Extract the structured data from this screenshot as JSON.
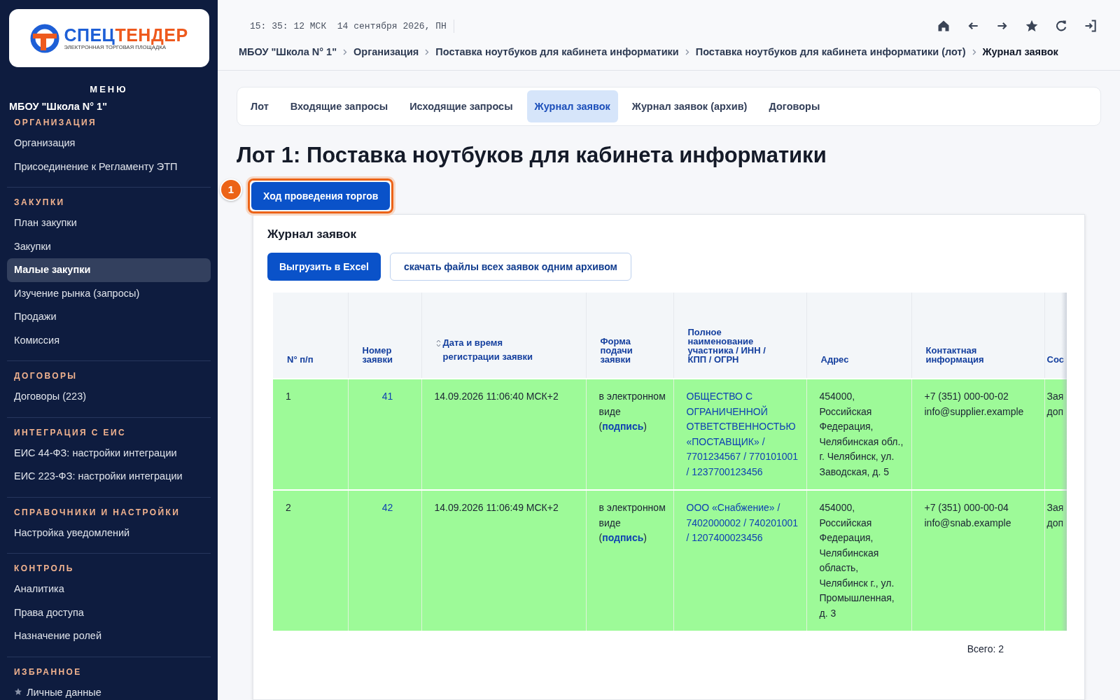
{
  "logo": {
    "title_parts": [
      "СПЕЦ",
      "ТЕНДЕР"
    ],
    "subtitle": "ЭЛЕКТРОННАЯ ТОРГОВАЯ ПЛОЩАДКА"
  },
  "sidebar": {
    "menu_title": "МЕНЮ",
    "org_name": "МБОУ \"Школа N° 1\"",
    "sections": [
      {
        "title": "ОРГАНИЗАЦИЯ",
        "kind": "links",
        "items": [
          {
            "label": "Организация",
            "selected": false
          },
          {
            "label": "Присоединение к Регламенту ЭТП",
            "selected": false
          }
        ]
      },
      {
        "title": "ЗАКУПКИ",
        "kind": "links",
        "items": [
          {
            "label": "План закупки",
            "selected": false
          },
          {
            "label": "Закупки",
            "selected": false
          },
          {
            "label": "Малые закупки",
            "selected": true
          },
          {
            "label": "Изучение рынка (запросы)",
            "selected": false
          },
          {
            "label": "Продажи",
            "selected": false
          },
          {
            "label": "Комиссия",
            "selected": false
          }
        ]
      },
      {
        "title": "ДОГОВОРЫ",
        "kind": "links",
        "items": [
          {
            "label": "Договоры (223)",
            "selected": false
          }
        ]
      },
      {
        "title": "ИНТЕГРАЦИЯ С ЕИС",
        "kind": "links",
        "items": [
          {
            "label": "ЕИС 44-ФЗ: настройки интеграции",
            "selected": false
          },
          {
            "label": "ЕИС 223-ФЗ: настройки интеграции",
            "selected": false
          }
        ]
      },
      {
        "title": "СПРАВОЧНИКИ И НАСТРОЙКИ",
        "kind": "links",
        "items": [
          {
            "label": "Настройка уведомлений",
            "selected": false
          }
        ]
      },
      {
        "title": "КОНТРОЛЬ",
        "kind": "links",
        "items": [
          {
            "label": "Аналитика",
            "selected": false
          },
          {
            "label": "Права доступа",
            "selected": false
          },
          {
            "label": "Назначение ролей",
            "selected": false
          }
        ]
      },
      {
        "title": "ИЗБРАННОЕ",
        "kind": "favorites",
        "items": [
          {
            "label": "Личные данные",
            "selected": false
          }
        ]
      }
    ]
  },
  "clock": "15: 35: 12 МСК  14 сентября 2026, ПН",
  "breadcrumbs": [
    {
      "label": "МБОУ \"Школа N° 1\"",
      "selected": false
    },
    {
      "label": "Организация",
      "selected": false
    },
    {
      "label": "Поставка ноутбуков для кабинета информатики",
      "selected": false
    },
    {
      "label": "Поставка ноутбуков для кабинета информатики (лот)",
      "selected": false
    },
    {
      "label": "Журнал заявок",
      "selected": true
    }
  ],
  "tabs": [
    {
      "label": "Лот",
      "selected": false
    },
    {
      "label": "Входящие запросы",
      "selected": false
    },
    {
      "label": "Исходящие запросы",
      "selected": false
    },
    {
      "label": "Журнал заявок",
      "selected": true
    },
    {
      "label": "Журнал заявок (архив)",
      "selected": false
    },
    {
      "label": "Договоры",
      "selected": false
    }
  ],
  "page_title": "Лот 1: Поставка ноутбуков для кабинета информатики",
  "progress_button": {
    "label": "Ход проведения торгов",
    "callout": "1"
  },
  "panel": {
    "title": "Журнал заявок",
    "buttons": [
      {
        "label": "Выгрузить в Excel",
        "kind": "primary"
      },
      {
        "label": "скачать файлы всех заявок одним архивом",
        "kind": "outline"
      }
    ]
  },
  "table": {
    "columns": [
      {
        "label": "N° п/п",
        "kind": "plain"
      },
      {
        "label": "Номер заявки",
        "kind": "plain"
      },
      {
        "label": "Дата и время регистрации заявки",
        "kind": "sortable"
      },
      {
        "label": "Форма подачи заявки",
        "kind": "plain"
      },
      {
        "label": "Полное наименование участника / ИНН / КПП / ОГРН",
        "kind": "plain"
      },
      {
        "label": "Адрес",
        "kind": "plain"
      },
      {
        "label": "Контактная информация",
        "kind": "plain"
      },
      {
        "label": "Сос",
        "kind": "plain"
      }
    ],
    "rows": [
      {
        "highlighted": true,
        "number": "1",
        "app_number": "41",
        "datetime": "14.09.2026 11:06:40 МСК+2",
        "form": {
          "text": "в электронном виде (",
          "link": "подпись",
          "suffix": ")"
        },
        "participant": "ОБЩЕСТВО С ОГРАНИЧЕННОЙ ОТВЕТСТВЕННОСТЬЮ «ПОСТАВЩИК» / 7701234567 / 770101001 / 1237700123456",
        "address": "454000, Российская Федерация, Челябинская обл., г. Челябинск, ул. Заводская, д. 5",
        "contact": [
          "+7 (351) 000-00-02",
          "info@supplier.example"
        ],
        "column_8": [
          "Зая",
          "доп"
        ]
      },
      {
        "highlighted": true,
        "number": "2",
        "app_number": "42",
        "datetime": "14.09.2026 11:06:49 МСК+2",
        "form": {
          "text": "в электронном виде (",
          "link": "подпись",
          "suffix": ")"
        },
        "participant": "ООО «Снабжение» / 7402000002 / 740201001 / 1207400023456",
        "address": "454000, Российская Федерация, Челябинская область, Челябинск г., ул. Промышленная, д. 3",
        "contact": [
          "+7 (351) 000-00-04",
          "info@snab.example"
        ],
        "column_8": [
          "Зая",
          "доп"
        ]
      }
    ],
    "total": "Всего: 2"
  }
}
